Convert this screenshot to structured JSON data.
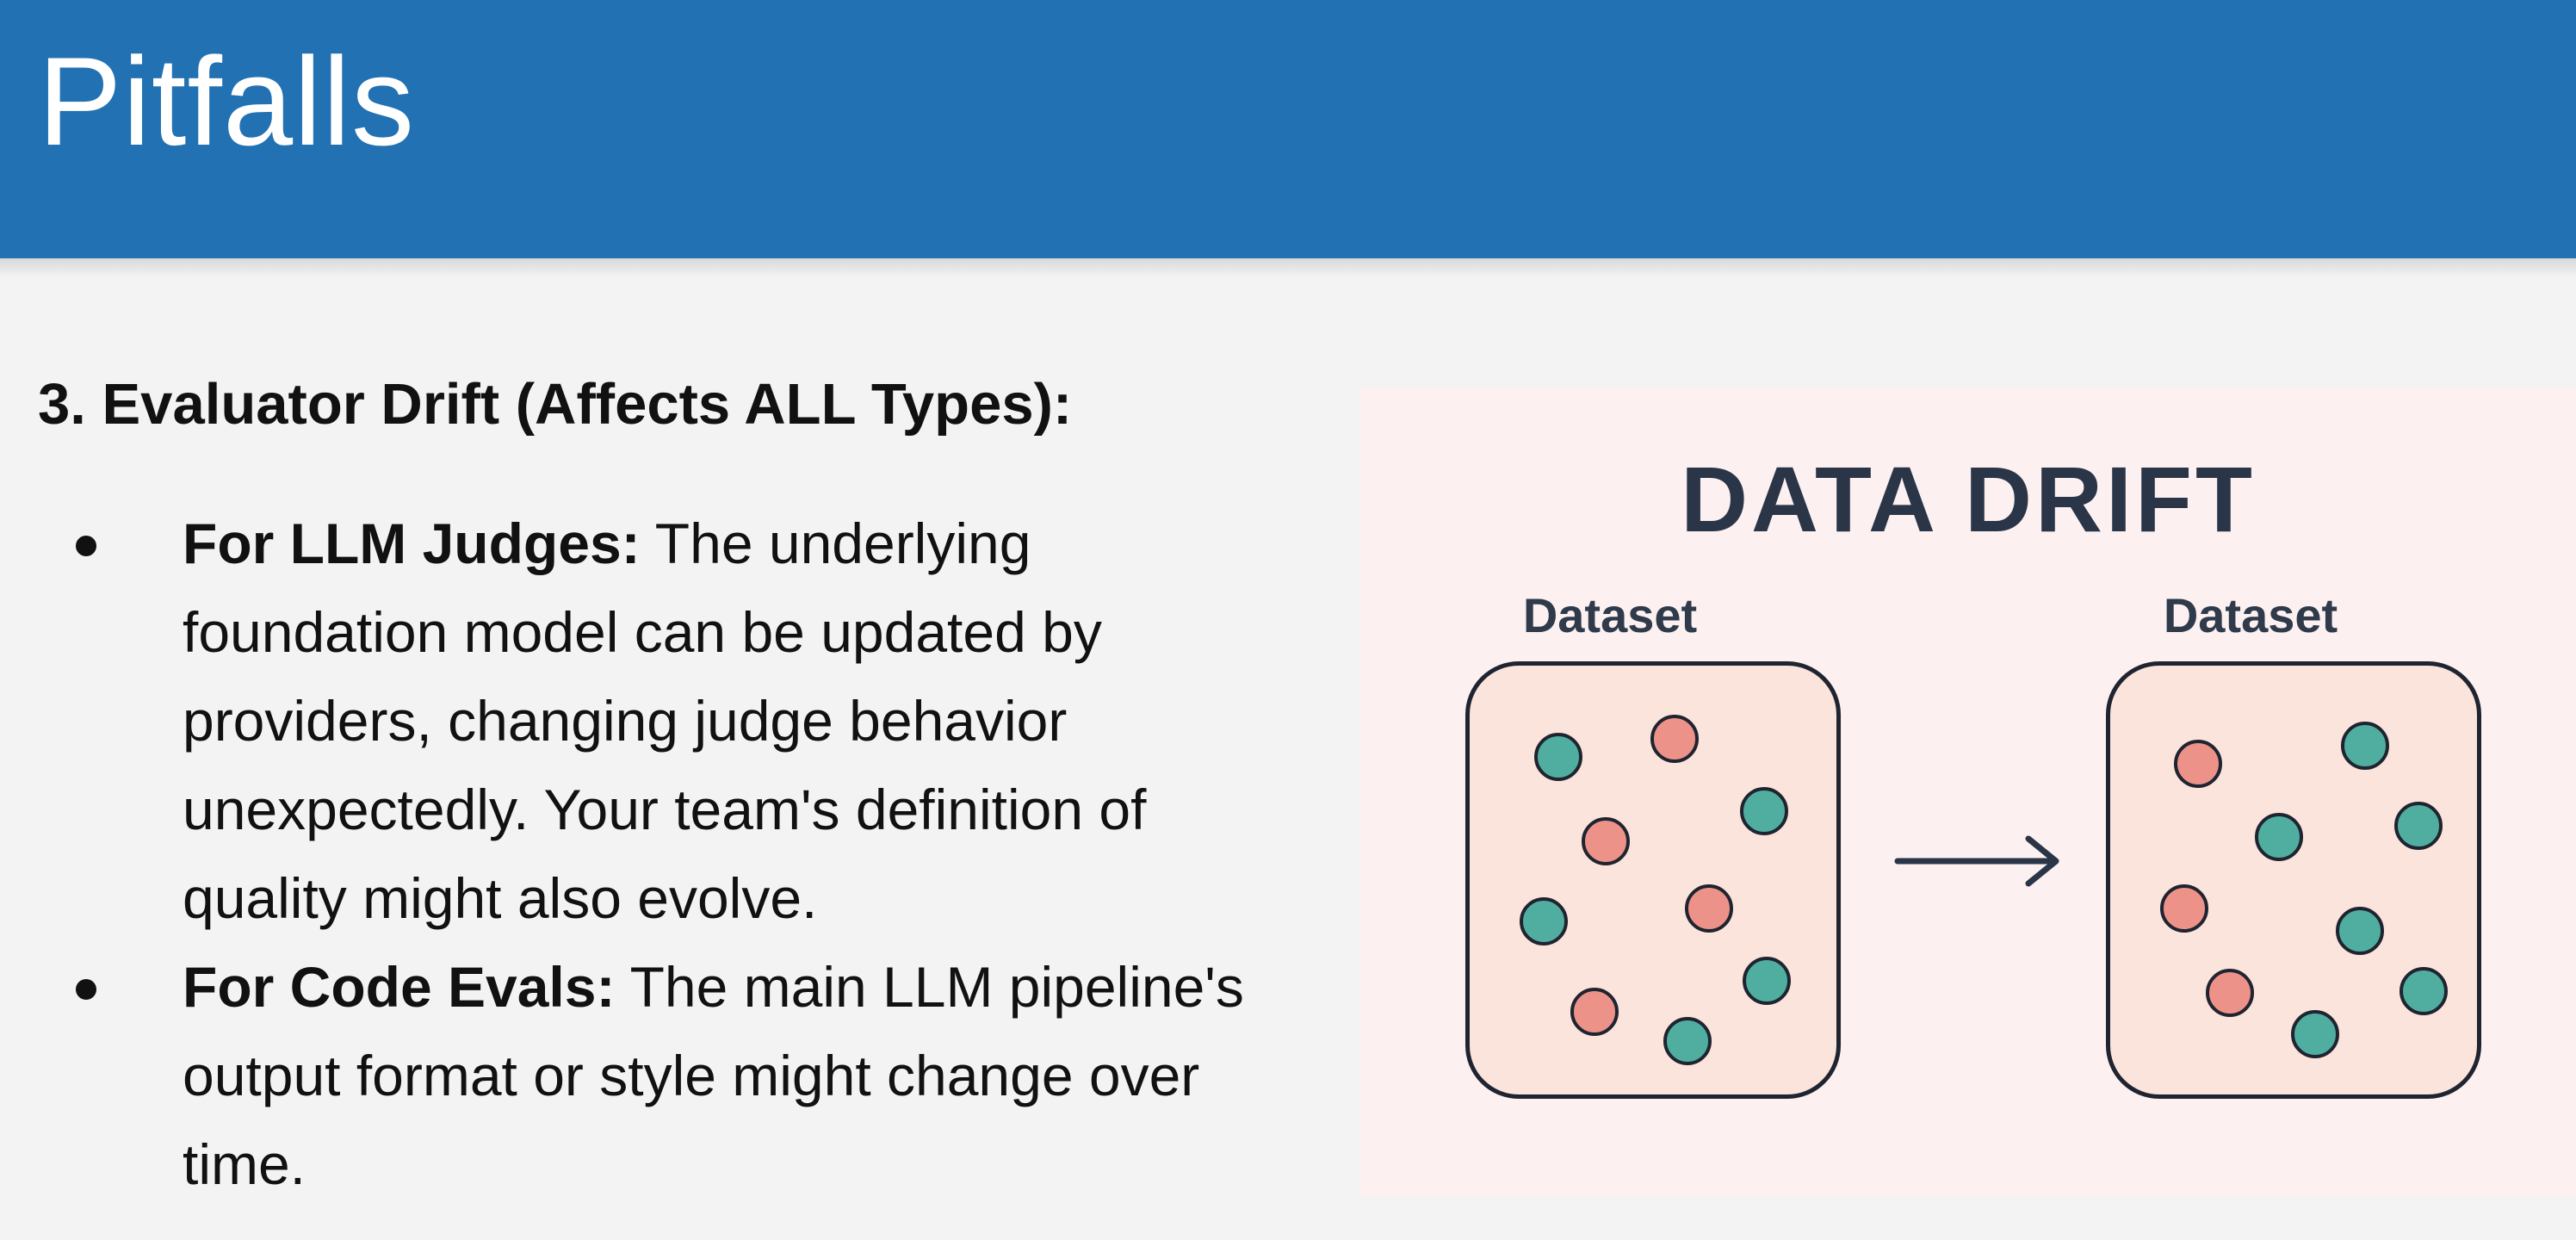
{
  "slide": {
    "title": "Pitfalls",
    "section_heading": "3. Evaluator Drift (Affects ALL Types):",
    "bullets": [
      {
        "strong": "For LLM Judges:",
        "text": " The underlying foundation model can be updated by providers, changing judge behavior unexpectedly. Your team's definition of quality might also evolve."
      },
      {
        "strong": "For Code Evals:",
        "text": " The main LLM pipeline's output format or style might change over time."
      }
    ]
  },
  "diagram": {
    "title": "DATA DRIFT",
    "left_label": "Dataset",
    "right_label": "Dataset",
    "arrow_icon": "right-arrow-icon",
    "colors": {
      "teal_dot": "#4fae9f",
      "pink_dot": "#ec9289",
      "box_fill": "#fbe4db",
      "title_bar": "#2272b3"
    }
  }
}
